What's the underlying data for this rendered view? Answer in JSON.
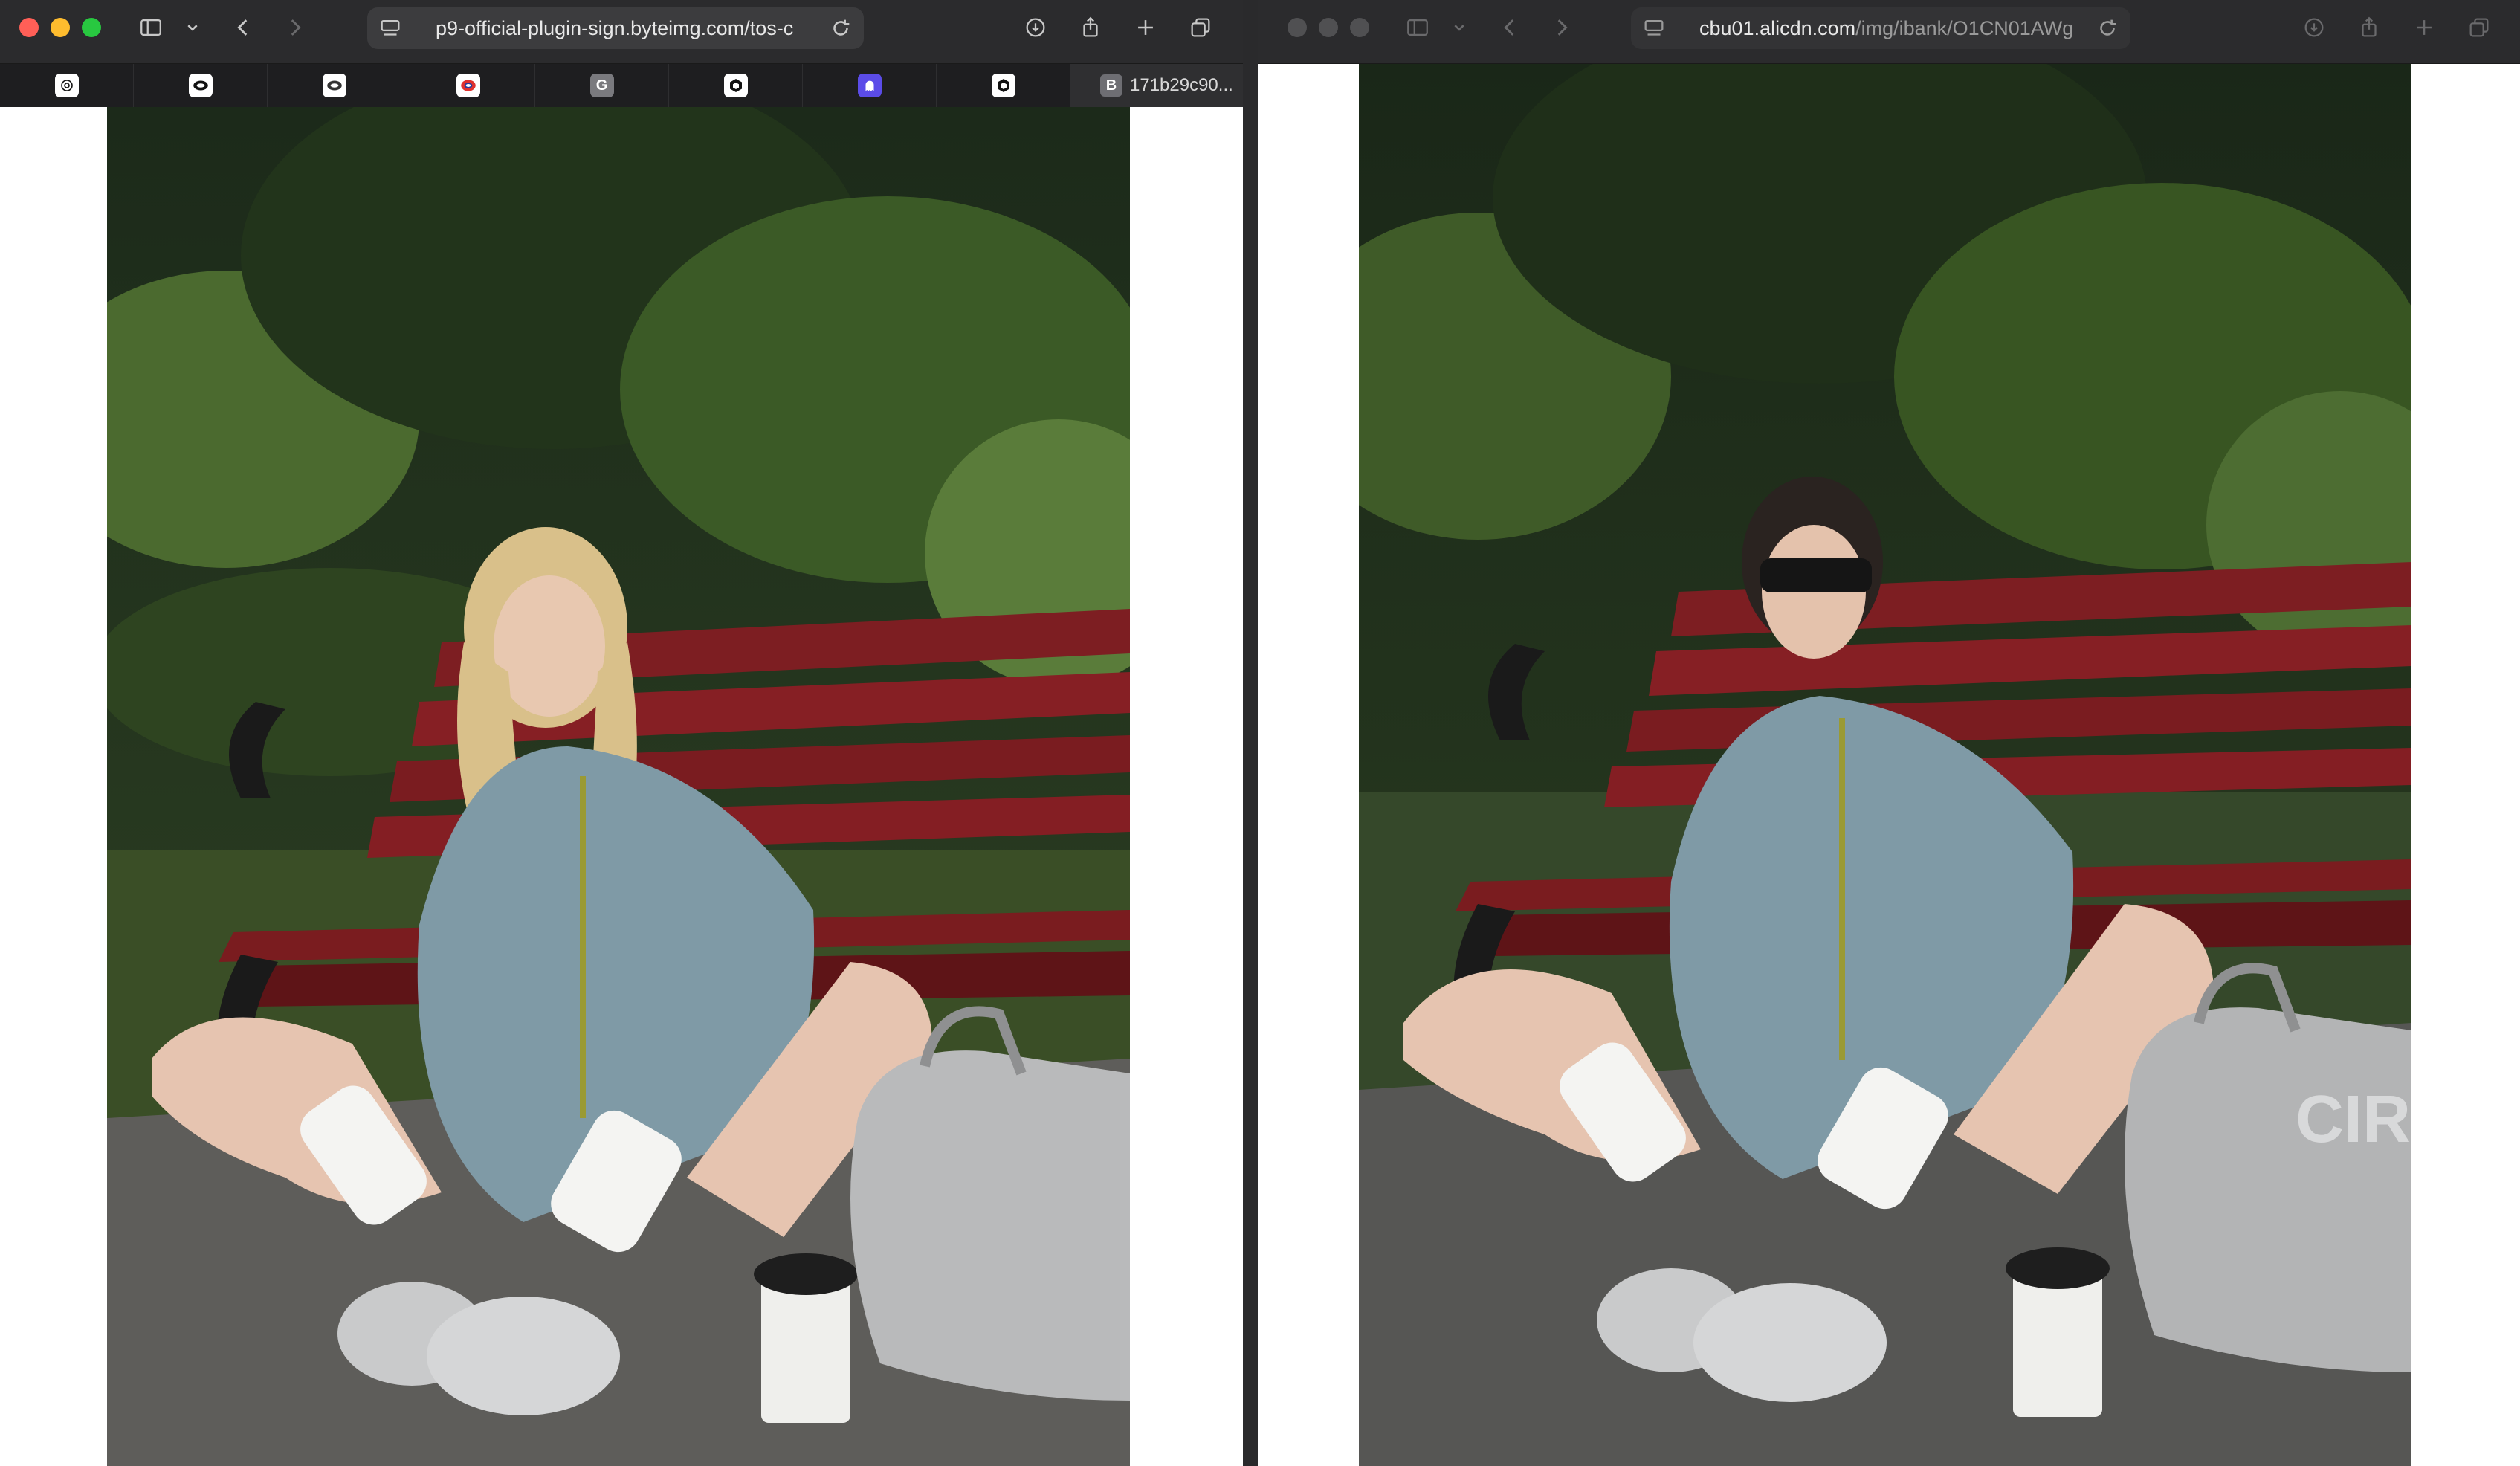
{
  "left_window": {
    "url": "p9-official-plugin-sign.byteimg.com/tos-c",
    "favorites": [
      {
        "name": "openai-icon",
        "letter": "",
        "color": "#ffffff"
      },
      {
        "name": "oval-app-icon",
        "letter": "",
        "color": "#ffffff"
      },
      {
        "name": "oval-app-icon",
        "letter": "",
        "color": "#ffffff"
      },
      {
        "name": "red-ring-icon",
        "letter": "",
        "color": "#e0322f"
      },
      {
        "name": "g-icon",
        "letter": "G",
        "color": "#7a7a7e"
      },
      {
        "name": "cube-icon",
        "letter": "",
        "color": "#ffffff"
      },
      {
        "name": "ghost-icon",
        "letter": "",
        "color": "#5b4ce8"
      },
      {
        "name": "cube-icon",
        "letter": "",
        "color": "#ffffff"
      }
    ],
    "active_tab": {
      "letter": "B",
      "label": "171b29c90..."
    },
    "photo": {
      "subject": "woman",
      "hair_color": "#d9c08a",
      "jacket_color": "#7f9aa6",
      "bench_color": "#8a1f22"
    }
  },
  "right_window": {
    "url_host": "cbu01.alicdn.com",
    "url_path": "/img/ibank/O1CN01AWg",
    "photo": {
      "subject": "woman",
      "hair_color": "#2a2320",
      "jacket_color": "#7f9aa6",
      "bench_color": "#8a1f22",
      "bag_text": "CIRC"
    }
  },
  "colors": {
    "close": "#ff5f57",
    "minimize": "#febc2e",
    "maximize": "#28c840",
    "inactive_dot": "#505052"
  }
}
